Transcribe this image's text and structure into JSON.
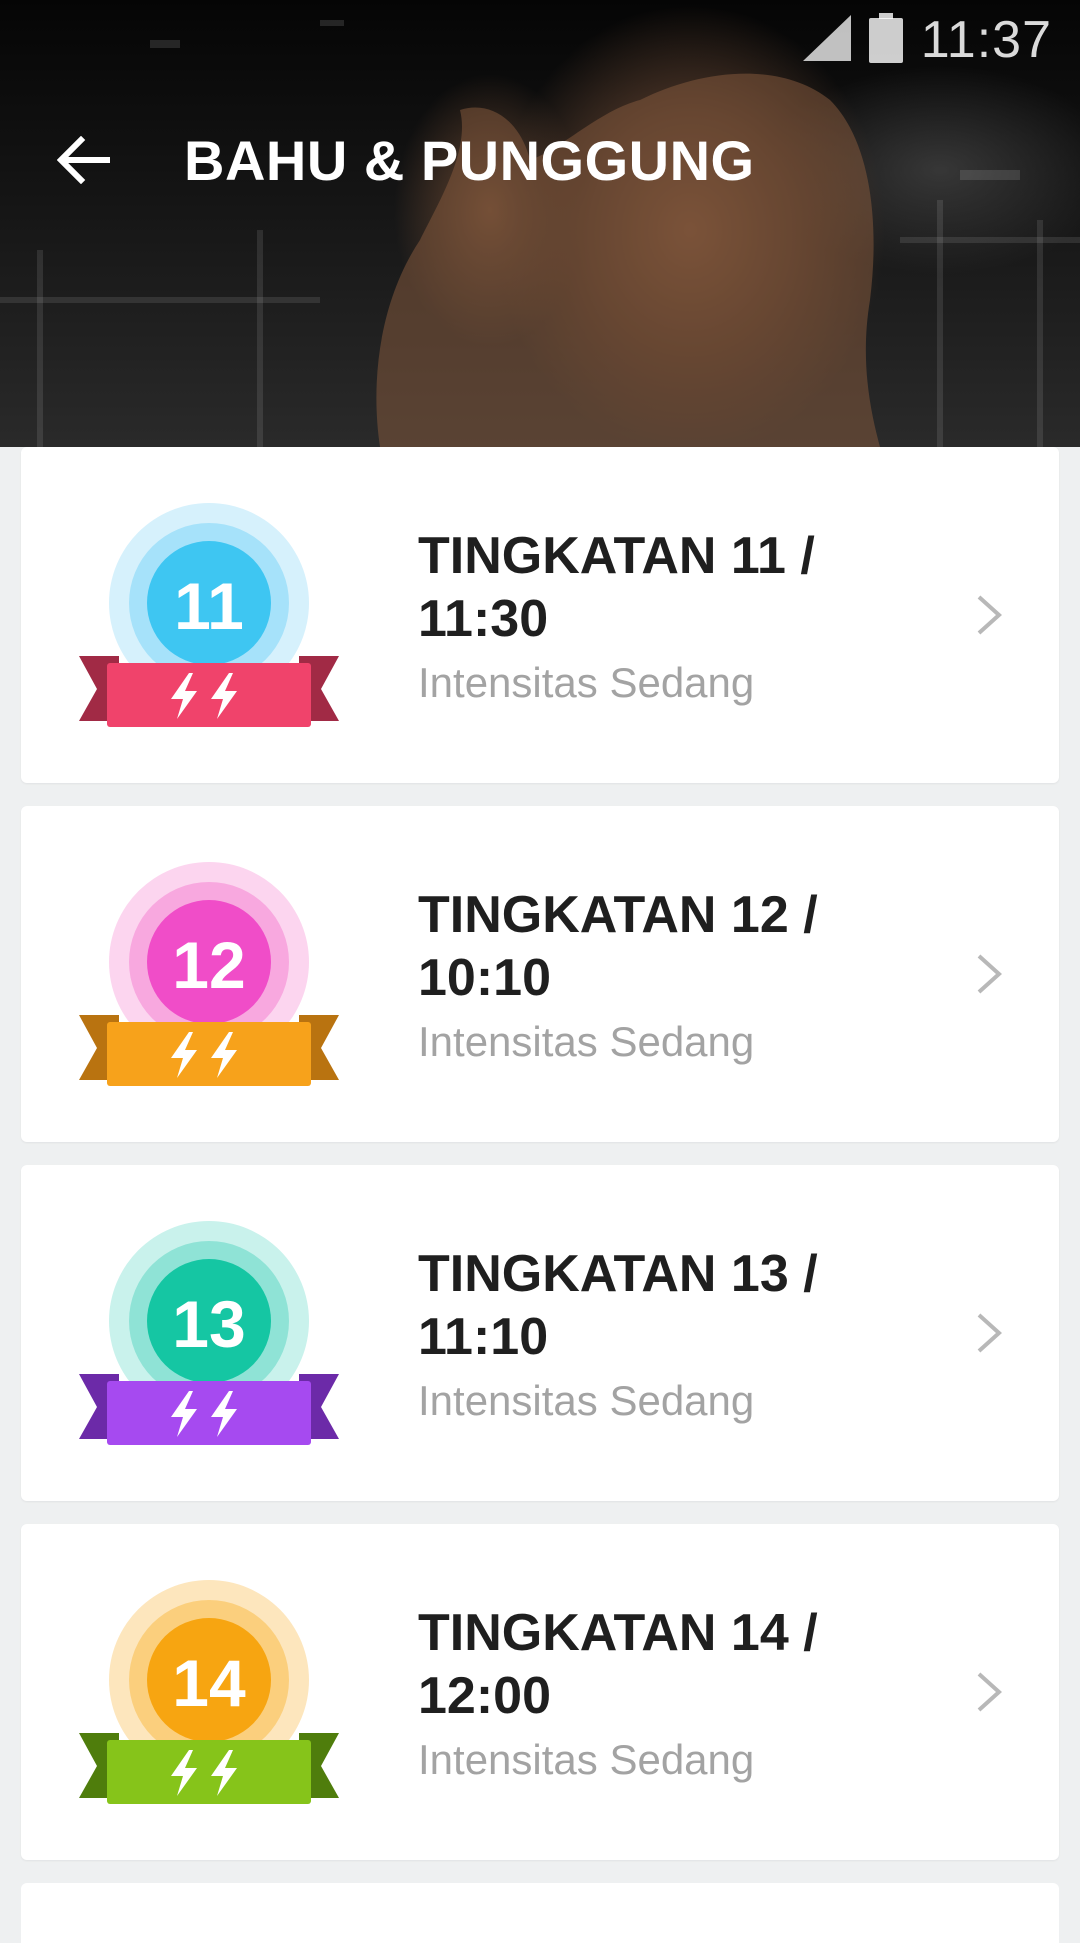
{
  "status_bar": {
    "time": "11:37",
    "icons": [
      "signal-icon",
      "battery-icon"
    ]
  },
  "toolbar": {
    "back_icon": "arrow-left-icon",
    "title": "BAHU & PUNGGUNG"
  },
  "levels": [
    {
      "title": "TINGKATAN 11 / 11:30",
      "subtitle": "Intensitas Sedang",
      "badge_number": "11",
      "colors": {
        "outer": "#d6f1fc",
        "middle": "#a6e2fa",
        "inner": "#3ec6f2",
        "ribbon": "#f0436b",
        "ribbon_dark": "#a12a45"
      }
    },
    {
      "title": "TINGKATAN 12 / 10:10",
      "subtitle": "Intensitas Sedang",
      "badge_number": "12",
      "colors": {
        "outer": "#fcd5ef",
        "middle": "#f8a8df",
        "inner": "#f04dc8",
        "ribbon": "#f7a21b",
        "ribbon_dark": "#b97310"
      }
    },
    {
      "title": "TINGKATAN 13 / 11:10",
      "subtitle": "Intensitas Sedang",
      "badge_number": "13",
      "colors": {
        "outer": "#c9f2ec",
        "middle": "#8fe3d6",
        "inner": "#15c6a3",
        "ribbon": "#a64af0",
        "ribbon_dark": "#6c2aa8"
      }
    },
    {
      "title": "TINGKATAN 14 / 12:00",
      "subtitle": "Intensitas Sedang",
      "badge_number": "14",
      "colors": {
        "outer": "#fde6bd",
        "middle": "#fbcf7d",
        "inner": "#f7a511",
        "ribbon": "#86c41a",
        "ribbon_dark": "#4f7d0c"
      }
    }
  ]
}
